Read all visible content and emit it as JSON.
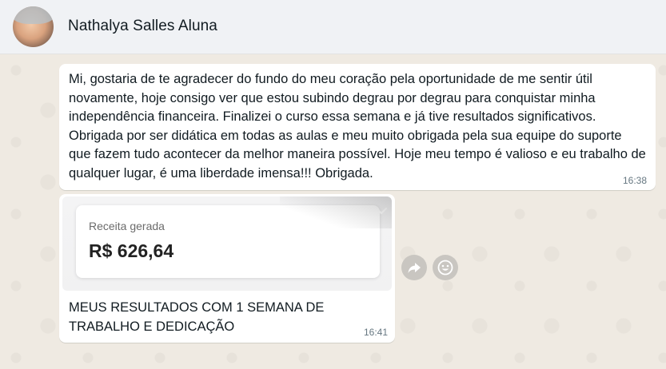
{
  "header": {
    "contact_name": "Nathalya Salles Aluna"
  },
  "messages": [
    {
      "type": "text",
      "text": "Mi, gostaria de te agradecer do fundo do meu coração pela oportunidade de me sentir útil novamente, hoje consigo ver que estou subindo degrau por degrau para conquistar minha independência financeira. Finalizei o curso essa semana e já tive resultados significativos. Obrigada por ser didática em todas as aulas e meu muito obrigada pela sua equipe do suporte que fazem tudo acontecer da melhor maneira possível. Hoje meu tempo é valioso e eu trabalho de qualquer lugar, é uma liberdade imensa!!! Obrigada.",
      "time": "16:38"
    },
    {
      "type": "image",
      "image_card": {
        "label": "Receita gerada",
        "value": "R$ 626,64"
      },
      "caption": "MEUS RESULTADOS COM 1 SEMANA DE TRABALHO E DEDICAÇÃO",
      "time": "16:41"
    }
  ],
  "actions": {
    "forward_icon": "forward-icon",
    "emoji_icon": "emoji-icon"
  },
  "colors": {
    "chat_bg": "#efeae2",
    "header_bg": "#f0f2f5",
    "bubble_bg": "#ffffff",
    "text": "#111b21",
    "time": "#667781"
  }
}
